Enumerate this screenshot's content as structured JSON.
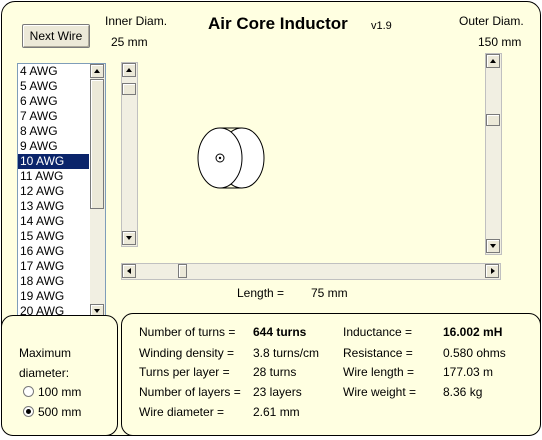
{
  "header": {
    "title": "Air Core Inductor",
    "version": "v1.9",
    "next_wire_label": "Next Wire",
    "inner_diam_label": "Inner Diam.",
    "inner_diam_value": "25 mm",
    "outer_diam_label": "Outer Diam.",
    "outer_diam_value": "150 mm"
  },
  "wire_list": {
    "items": [
      "4 AWG",
      "5 AWG",
      "6 AWG",
      "7 AWG",
      "8 AWG",
      "9 AWG",
      "10 AWG",
      "11 AWG",
      "12 AWG",
      "13 AWG",
      "14 AWG",
      "15 AWG",
      "16 AWG",
      "17 AWG",
      "18 AWG",
      "19 AWG",
      "20 AWG"
    ],
    "selected": "10 AWG"
  },
  "length": {
    "label": "Length =",
    "value": "75 mm"
  },
  "max_diameter": {
    "label_line1": "Maximum",
    "label_line2": "diameter:",
    "options": [
      "100 mm",
      "500 mm"
    ],
    "selected": "500 mm"
  },
  "stats": {
    "turns_label": "Number of turns =",
    "turns_value": "644 turns",
    "density_label": "Winding density =",
    "density_value": "3.8 turns/cm",
    "per_layer_label": "Turns per layer =",
    "per_layer_value": "28 turns",
    "layers_label": "Number of layers =",
    "layers_value": "23 layers",
    "wire_diam_label": "Wire diameter =",
    "wire_diam_value": "2.61 mm",
    "inductance_label": "Inductance =",
    "inductance_value": "16.002 mH",
    "resistance_label": "Resistance =",
    "resistance_value": "0.580 ohms",
    "wire_length_label": "Wire length =",
    "wire_length_value": "177.03 m",
    "wire_weight_label": "Wire weight =",
    "wire_weight_value": "8.36 kg"
  },
  "colors": {
    "panel_bg": "#ffffe1",
    "selection": "#0a246a"
  }
}
